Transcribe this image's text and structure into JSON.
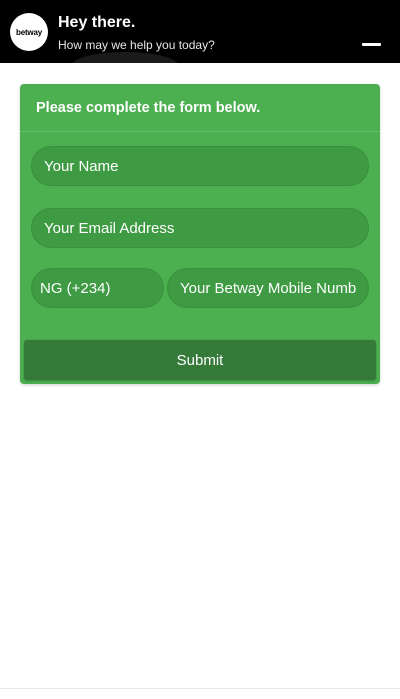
{
  "header": {
    "logo_text": "betway",
    "title": "Hey there.",
    "subtitle": "How may we help you today?"
  },
  "form": {
    "heading": "Please complete the form below.",
    "name_placeholder": "Your Name",
    "email_placeholder": "Your Email Address",
    "country_code": "NG (+234)",
    "mobile_placeholder": "Your Betway Mobile Number",
    "submit_label": "Submit"
  },
  "colors": {
    "header_bg": "#000000",
    "card_bg": "#4caf50",
    "field_bg": "#3f9b43",
    "submit_bg": "#357a38"
  }
}
